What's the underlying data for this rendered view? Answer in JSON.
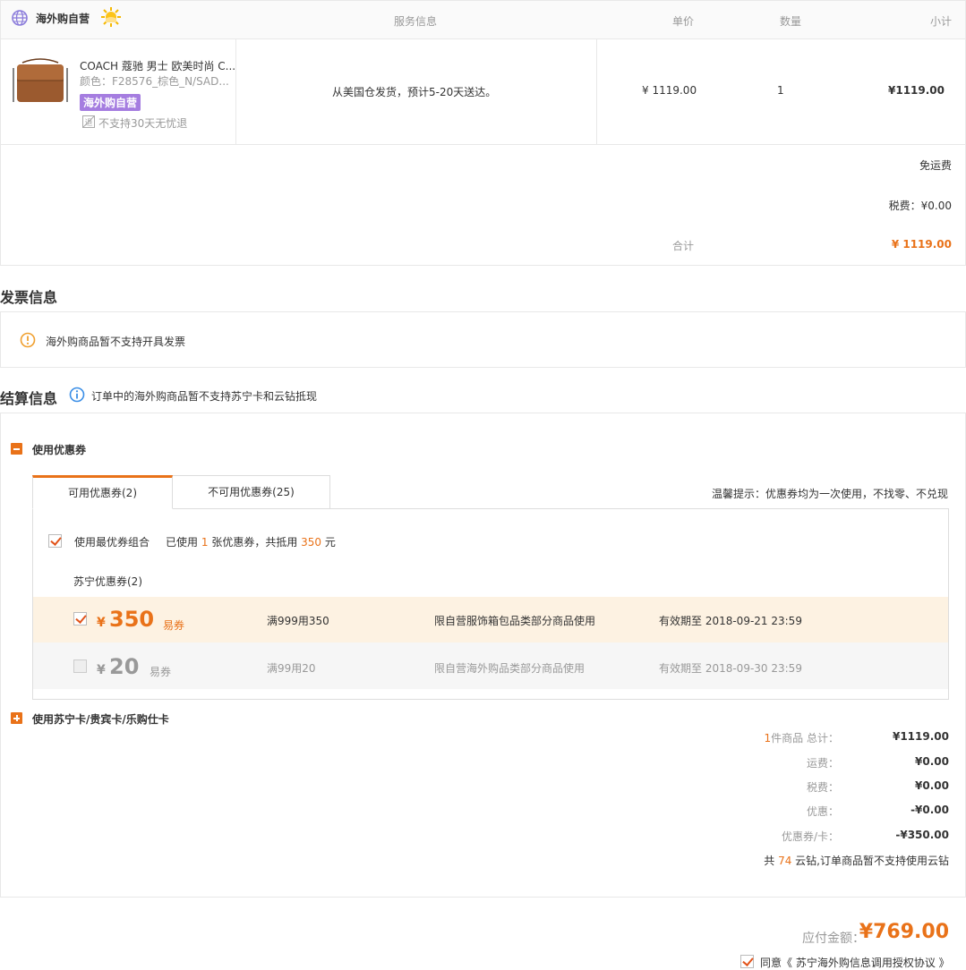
{
  "header": {
    "shop_name": "海外购自营",
    "col_service": "服务信息",
    "col_unit_price": "单价",
    "col_quantity": "数量",
    "col_subtotal": "小计"
  },
  "product": {
    "name": "COACH 蔻驰 男士 欧美时尚 C...",
    "spec": "颜色：F28576_棕色_N/SAD...",
    "badge": "海外购自营",
    "return_policy": "不支持30天无忧退",
    "service_info": "从美国仓发货，预计5-20天送达。",
    "unit_price": "¥ 1119.00",
    "quantity": "1",
    "subtotal": "¥1119.00"
  },
  "summary": {
    "shipping": "免运费",
    "tax": "税费：¥0.00",
    "total_label": "合计",
    "total_value": "¥ 1119.00"
  },
  "invoice": {
    "title": "发票信息",
    "notice": "海外购商品暂不支持开具发票"
  },
  "settlement": {
    "title": "结算信息",
    "notice": "订单中的海外购商品暂不支持苏宁卡和云钻抵现",
    "coupon_section": "使用优惠券",
    "tab_available": "可用优惠券(2)",
    "tab_unavailable": "不可用优惠券(25)",
    "tip": "温馨提示：优惠券均为一次使用，不找零、不兑现",
    "best_combo_label": "使用最优券组合",
    "used_prefix": "已使用",
    "used_count": "1",
    "used_mid": "张优惠券，共抵用",
    "used_amount": "350",
    "used_suffix": "元",
    "group_label": "苏宁优惠券(2)",
    "coupons": [
      {
        "currency": "¥",
        "amount": "350",
        "type": "易券",
        "condition": "满999用350",
        "scope": "限自营服饰箱包品类部分商品使用",
        "validity": "有效期至 2018-09-21 23:59",
        "checked": true
      },
      {
        "currency": "¥",
        "amount": "20",
        "type": "易券",
        "condition": "满99用20",
        "scope": "限自营海外购品类部分商品使用",
        "validity": "有效期至 2018-09-30 23:59",
        "checked": false
      }
    ],
    "card_section": "使用苏宁卡/贵宾卡/乐购仕卡"
  },
  "totals": {
    "goods_count": "1",
    "goods_label": "件商品 总计：",
    "goods_value": "¥1119.00",
    "shipping_label": "运费：",
    "shipping_value": "¥0.00",
    "tax_label": "税费：",
    "tax_value": "¥0.00",
    "discount_label": "优惠：",
    "discount_value": "-¥0.00",
    "coupon_label": "优惠券/卡：",
    "coupon_value": "-¥350.00",
    "yunzuan_prefix": "共",
    "yunzuan_count": "74",
    "yunzuan_suffix": "云钻,订单商品暂不支持使用云钻"
  },
  "payment": {
    "label": "应付金额：",
    "amount": "¥769.00",
    "agree_prefix": "同意",
    "agree_link": "《 苏宁海外购信息调用授权协议 》"
  },
  "colors": {
    "accent": "#e97219",
    "badge": "#a57de0",
    "selected_row": "#fdf2e2"
  },
  "icons": [
    "globe-icon",
    "sun-icon",
    "no-return-icon",
    "warning-icon",
    "info-icon",
    "collapse-icon",
    "expand-icon",
    "checkbox-icon"
  ]
}
